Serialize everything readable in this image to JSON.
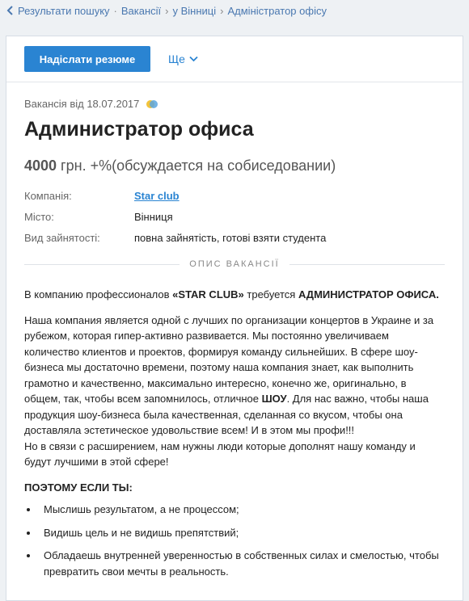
{
  "breadcrumb": {
    "back_label": "Результати пошуку",
    "item2": "Вакансії",
    "item3": "у Вінниці",
    "item4": "Адміністратор офісу"
  },
  "toolbar": {
    "send_resume": "Надіслати резюме",
    "more": "Ще"
  },
  "vacancy": {
    "posted": "Вакансія від 18.07.2017",
    "title": "Администратор офиса",
    "salary_amount": "4000",
    "salary_rest": " грн. +%(обсуждается на собиседовании)",
    "company_label": "Компанія:",
    "company_value": "Star club",
    "city_label": "Місто:",
    "city_value": "Вінниця",
    "employment_label": "Вид зайнятості:",
    "employment_value": "повна зайнятість, готові взяти студента"
  },
  "section": {
    "title": "ОПИС ВАКАНСІЇ"
  },
  "description": {
    "intro_pre": "В компанию профессионалов ",
    "intro_brand": "«STAR CLUB»",
    "intro_mid": " требуется ",
    "intro_role": "АДМИНИСТРАТОР ОФИСА.",
    "p1_a": "Наша компания является одной с лучших по организации концертов в Украине и за рубежом, которая гипер-активно развивается. Мы постоянно увеличиваем количество клиентов и проектов, формируя команду сильнейших. В сфере шоу-бизнеса мы достаточно времени, поэтому наша компания знает, как выполнить грамотно и качественно, максимально интересно, конечно же, оригинально, в общем, так, чтобы всем запомнилось, отличное ",
    "p1_show": "ШОУ",
    "p1_b": ". Для нас важно, чтобы наша продукция шоу-бизнеса была качественная, сделанная со вкусом, чтобы она доставляла эстетическое удовольствие всем! И в этом мы профи!!!",
    "p2": "Но в связи с расширением, нам нужны люди которые дополнят нашу команду и будут лучшими в этой сфере!",
    "list_head": "ПОЭТОМУ ЕСЛИ ТЫ:",
    "items": [
      "Мыслишь результатом, а не процессом;",
      "Видишь цель и не видишь препятствий;",
      "Обладаешь внутренней уверенностью в собственных силах и смелостью, чтобы превратить свои мечты в реальность."
    ]
  },
  "colors": {
    "accent": "#2a84d2",
    "link": "#4a78b0",
    "background": "#eef1f4"
  }
}
